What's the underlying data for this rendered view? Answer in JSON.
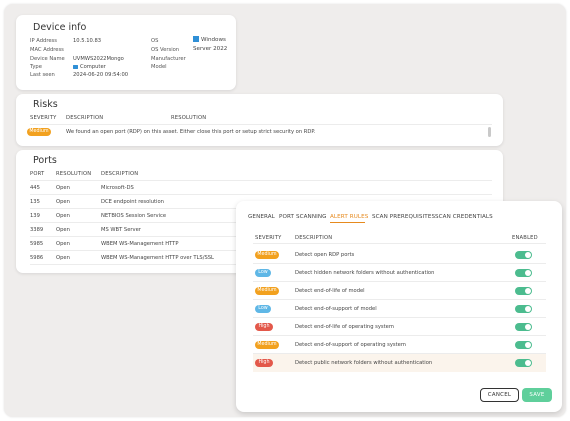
{
  "device_info": {
    "title": "Device info",
    "left_fields": [
      {
        "label": "IP Address",
        "value": "10.5.10.83"
      },
      {
        "label": "MAC Address",
        "value": ""
      },
      {
        "label": "Device Name",
        "value": "UVMWS2022Mongo"
      },
      {
        "label": "Type",
        "value": "Computer",
        "icon": "computer-icon"
      },
      {
        "label": "Last seen",
        "value": "2024-06-20 09:54:00"
      }
    ],
    "right_fields": [
      {
        "label": "OS",
        "value": "Windows",
        "icon": "windows-icon"
      },
      {
        "label": "OS Version",
        "value": "Server 2022"
      },
      {
        "label": "Manufacturer",
        "value": ""
      },
      {
        "label": "Model",
        "value": ""
      }
    ]
  },
  "risks": {
    "title": "Risks",
    "headers": {
      "severity": "SEVERITY",
      "description": "DESCRIPTION",
      "resolution": "RESOLUTION"
    },
    "rows": [
      {
        "severity": "Medium",
        "text": "We found an open port (RDP) on this asset. Either close this port or setup strict security on RDP."
      }
    ]
  },
  "ports": {
    "title": "Ports",
    "headers": {
      "port": "PORT",
      "resolution": "RESOLUTION",
      "description": "DESCRIPTION"
    },
    "rows": [
      {
        "port": "445",
        "resolution": "Open",
        "description": "Microsoft-DS"
      },
      {
        "port": "135",
        "resolution": "Open",
        "description": "DCE endpoint resolution"
      },
      {
        "port": "139",
        "resolution": "Open",
        "description": "NETBIOS Session Service"
      },
      {
        "port": "3389",
        "resolution": "Open",
        "description": "MS WBT Server"
      },
      {
        "port": "5985",
        "resolution": "Open",
        "description": "WBEM WS-Management HTTP"
      },
      {
        "port": "5986",
        "resolution": "Open",
        "description": "WBEM WS-Management HTTP over TLS/SSL"
      }
    ]
  },
  "alert_modal": {
    "tabs": [
      {
        "label": "GENERAL",
        "active": false
      },
      {
        "label": "PORT SCANNING",
        "active": false
      },
      {
        "label": "ALERT RULES",
        "active": true
      },
      {
        "label": "SCAN PREREQUISITES",
        "active": false
      },
      {
        "label": "SCAN CREDENTIALS",
        "active": false
      }
    ],
    "headers": {
      "severity": "SEVERITY",
      "description": "DESCRIPTION",
      "enabled": "ENABLED"
    },
    "rules": [
      {
        "severity": "Medium",
        "description": "Detect open RDP ports",
        "enabled": true
      },
      {
        "severity": "Low",
        "description": "Detect hidden network folders without authentication",
        "enabled": true
      },
      {
        "severity": "Medium",
        "description": "Detect end-of-life of model",
        "enabled": true
      },
      {
        "severity": "Low",
        "description": "Detect end-of-support of model",
        "enabled": true
      },
      {
        "severity": "High",
        "description": "Detect end-of-life of operating system",
        "enabled": true
      },
      {
        "severity": "Medium",
        "description": "Detect end-of-support of operating system",
        "enabled": true
      },
      {
        "severity": "High",
        "description": "Detect public network folders without authentication",
        "enabled": true
      }
    ],
    "cancel_label": "CANCEL",
    "save_label": "SAVE"
  },
  "colors": {
    "medium": "#f2a11f",
    "low": "#5fb7e6",
    "high": "#e3584a",
    "toggle_on": "#4cbc8f",
    "accent": "#e68a1e",
    "save": "#5fcf9b"
  }
}
